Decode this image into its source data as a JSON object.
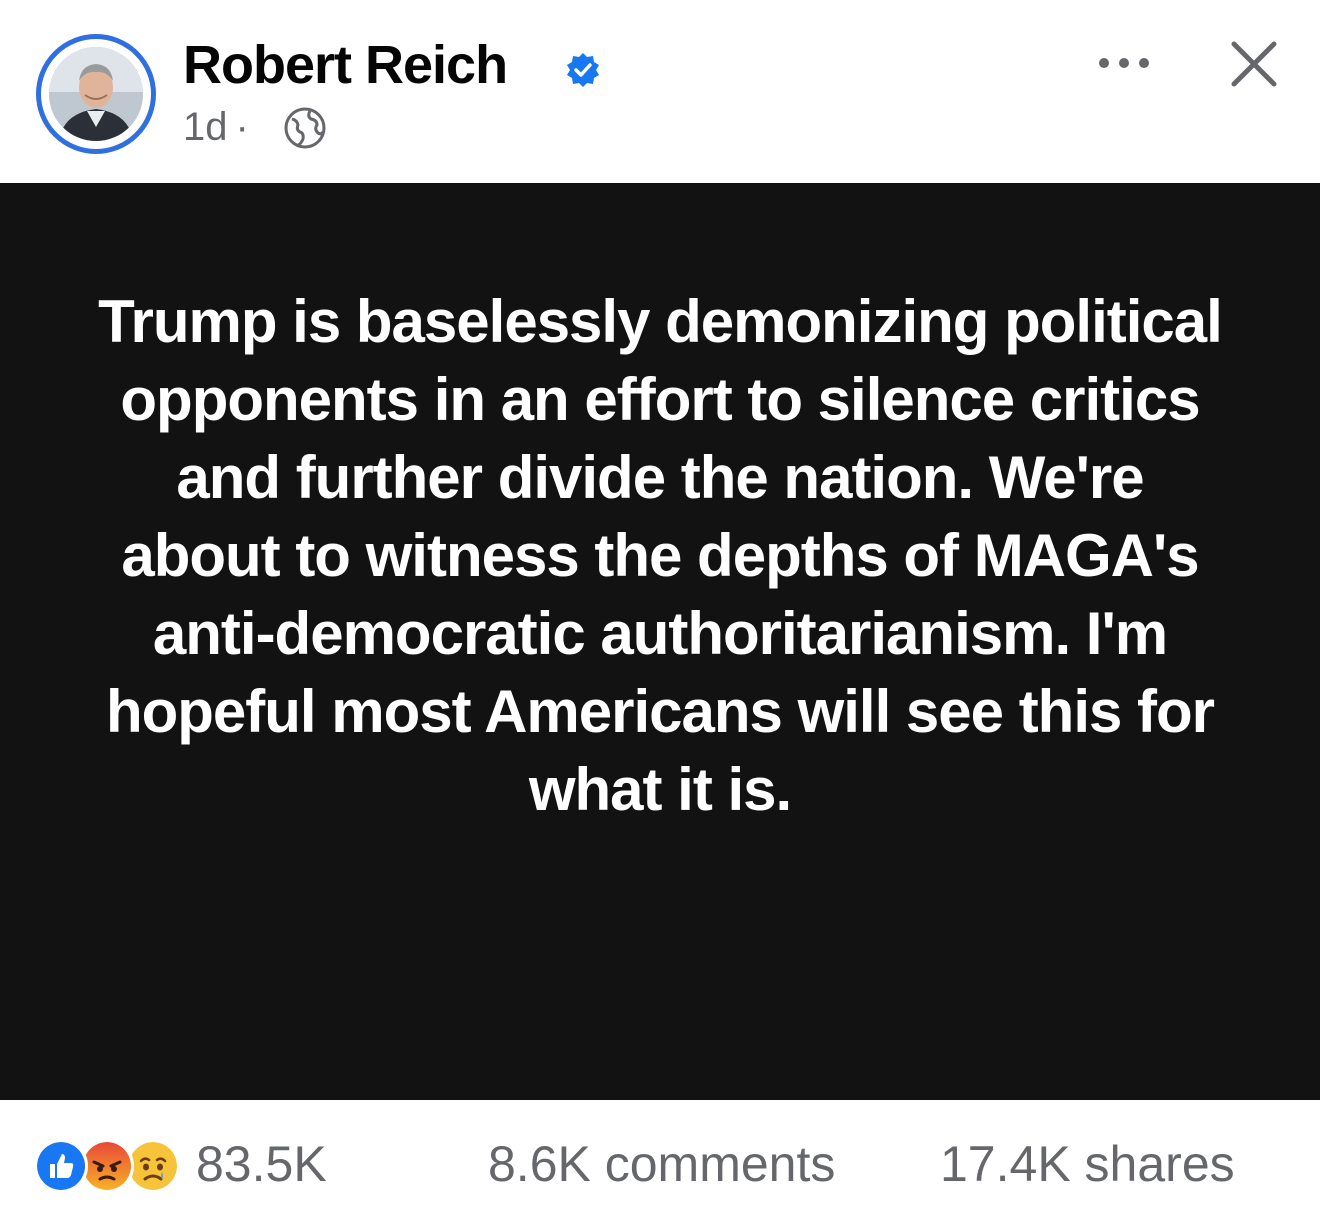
{
  "post": {
    "author": "Robert Reich",
    "time": "1d",
    "separator": "·",
    "audience_icon": "globe-icon",
    "verified_icon": "verified-badge-icon",
    "text": "Trump is baselessly demonizing political opponents in an effort to silence critics and further divide the nation. We're about to witness the depths of MAGA's anti-democratic authoritarianism. I'm hopeful most Americans will see this for what it is."
  },
  "stats": {
    "reactions_count": "83.5K",
    "comments": "8.6K comments",
    "shares": "17.4K shares",
    "reaction_icons": [
      "like-icon",
      "angry-icon",
      "sad-icon"
    ]
  },
  "colors": {
    "accent": "#2f6fe0",
    "post_background": "#121212",
    "secondary_text": "#65676b"
  }
}
